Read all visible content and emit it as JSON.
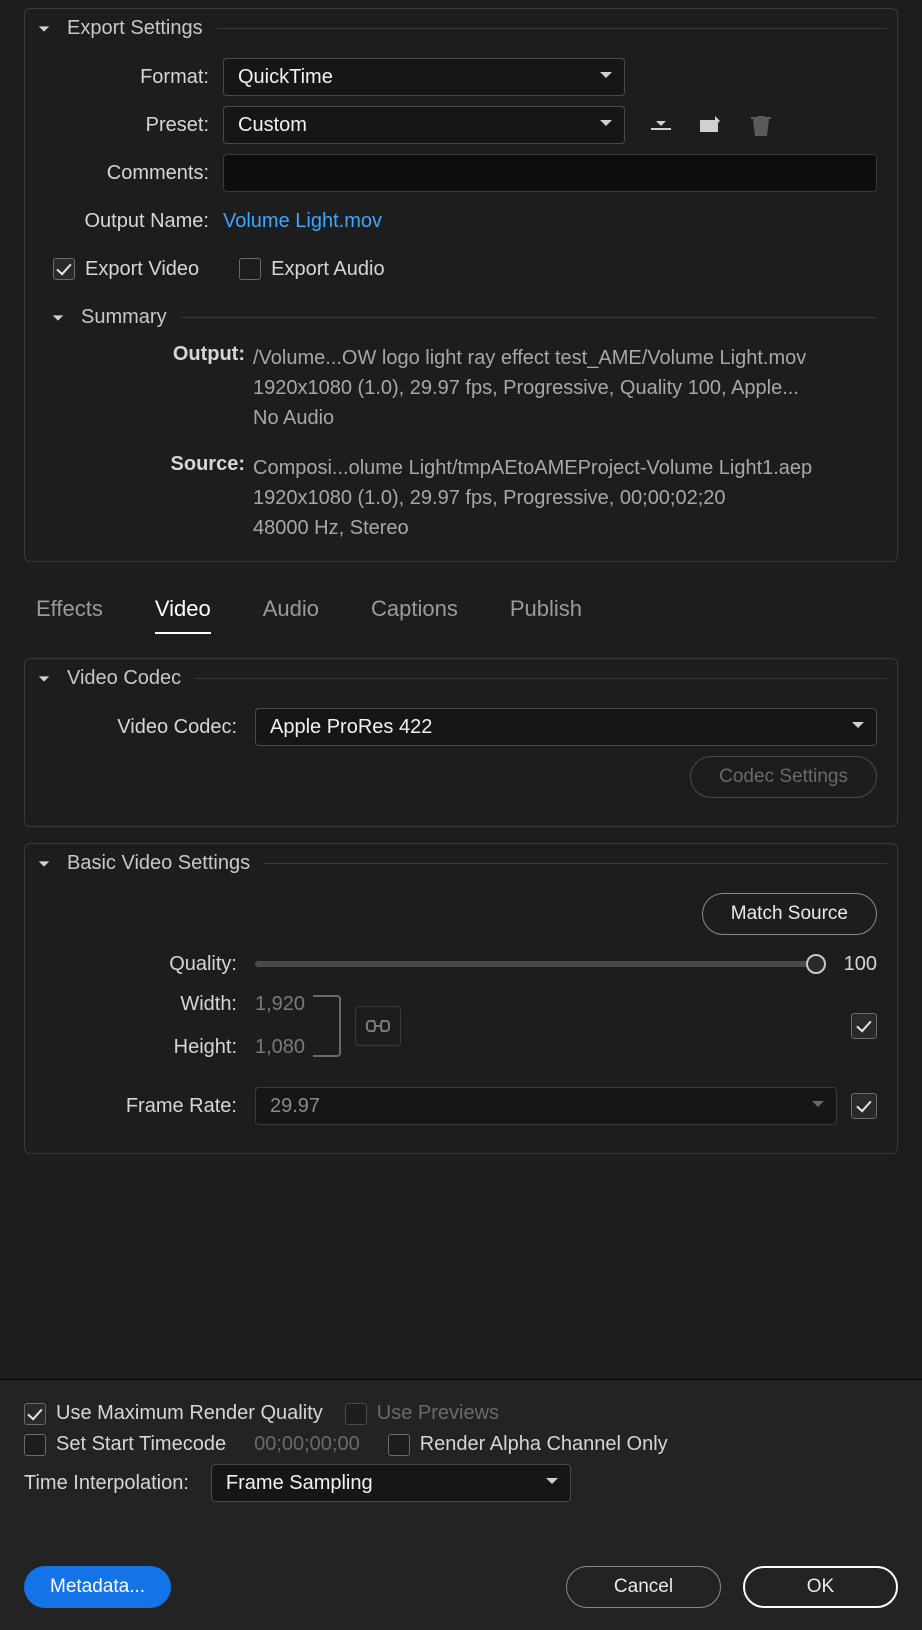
{
  "exportSettings": {
    "title": "Export Settings",
    "formatLabel": "Format:",
    "formatValue": "QuickTime",
    "presetLabel": "Preset:",
    "presetValue": "Custom",
    "commentsLabel": "Comments:",
    "commentsValue": "",
    "outputNameLabel": "Output Name:",
    "outputNameValue": "Volume Light.mov",
    "exportVideoLabel": "Export Video",
    "exportVideoChecked": true,
    "exportAudioLabel": "Export Audio",
    "exportAudioChecked": false,
    "summary": {
      "title": "Summary",
      "outputLabel": "Output:",
      "outputText": "/Volume...OW logo light ray effect test_AME/Volume Light.mov\n1920x1080 (1.0), 29.97 fps, Progressive, Quality 100, Apple...\nNo Audio",
      "sourceLabel": "Source:",
      "sourceText": "Composi...olume Light/tmpAEtoAMEProject-Volume Light1.aep\n1920x1080 (1.0), 29.97 fps, Progressive, 00;00;02;20\n48000 Hz, Stereo"
    }
  },
  "tabs": {
    "effects": "Effects",
    "video": "Video",
    "audio": "Audio",
    "captions": "Captions",
    "publish": "Publish"
  },
  "videoCodec": {
    "title": "Video Codec",
    "codecLabel": "Video Codec:",
    "codecValue": "Apple ProRes 422",
    "codecSettingsBtn": "Codec Settings"
  },
  "basicVideo": {
    "title": "Basic Video Settings",
    "matchSourceBtn": "Match Source",
    "qualityLabel": "Quality:",
    "qualityValue": "100",
    "widthLabel": "Width:",
    "widthValue": "1,920",
    "heightLabel": "Height:",
    "heightValue": "1,080",
    "frameRateLabel": "Frame Rate:",
    "frameRateValue": "29.97"
  },
  "footer": {
    "maxRender": "Use Maximum Render Quality",
    "usePreviews": "Use Previews",
    "setStart": "Set Start Timecode",
    "timecode": "00;00;00;00",
    "renderAlpha": "Render Alpha Channel Only",
    "timeInterpLabel": "Time Interpolation:",
    "timeInterpValue": "Frame Sampling",
    "metadataBtn": "Metadata...",
    "cancelBtn": "Cancel",
    "okBtn": "OK"
  }
}
